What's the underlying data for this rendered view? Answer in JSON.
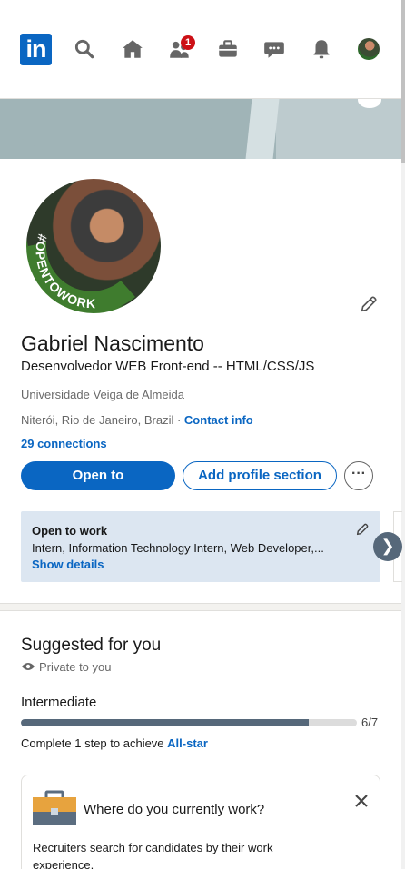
{
  "nav": {
    "logo_text": "in",
    "network_badge": "1",
    "icons": [
      "search-icon",
      "home-icon",
      "my-network-icon",
      "jobs-icon",
      "messaging-icon",
      "notifications-icon",
      "me-avatar"
    ]
  },
  "profile": {
    "name": "Gabriel Nascimento",
    "headline": "Desenvolvedor WEB Front-end -- HTML/CSS/JS",
    "education": "Universidade Veiga de Almeida",
    "location": "Niterói, Rio de Janeiro, Brazil",
    "location_sep": " · ",
    "contact_info": "Contact info",
    "connections": "29 connections",
    "frame_text": "#OPENTOWORK"
  },
  "actions": {
    "open_to": "Open to",
    "add_section": "Add profile section",
    "more": "···"
  },
  "open_to_work": {
    "title": "Open to work",
    "roles": "Intern, Information Technology Intern, Web Developer,...",
    "show_details": "Show details"
  },
  "suggested": {
    "title": "Suggested for you",
    "private": "Private to you",
    "level": "Intermediate",
    "progress_text": "6/7",
    "progress_fraction": 0.857,
    "step_text": "Complete 1 step to achieve ",
    "step_link": "All-star"
  },
  "work_card": {
    "question": "Where do you currently work?",
    "description": "Recruiters search for candidates by their work experience."
  },
  "colors": {
    "brand": "#0a66c2",
    "badge": "#cc1016",
    "progress": "#56687a",
    "frame_green": "#3f7c2e"
  }
}
